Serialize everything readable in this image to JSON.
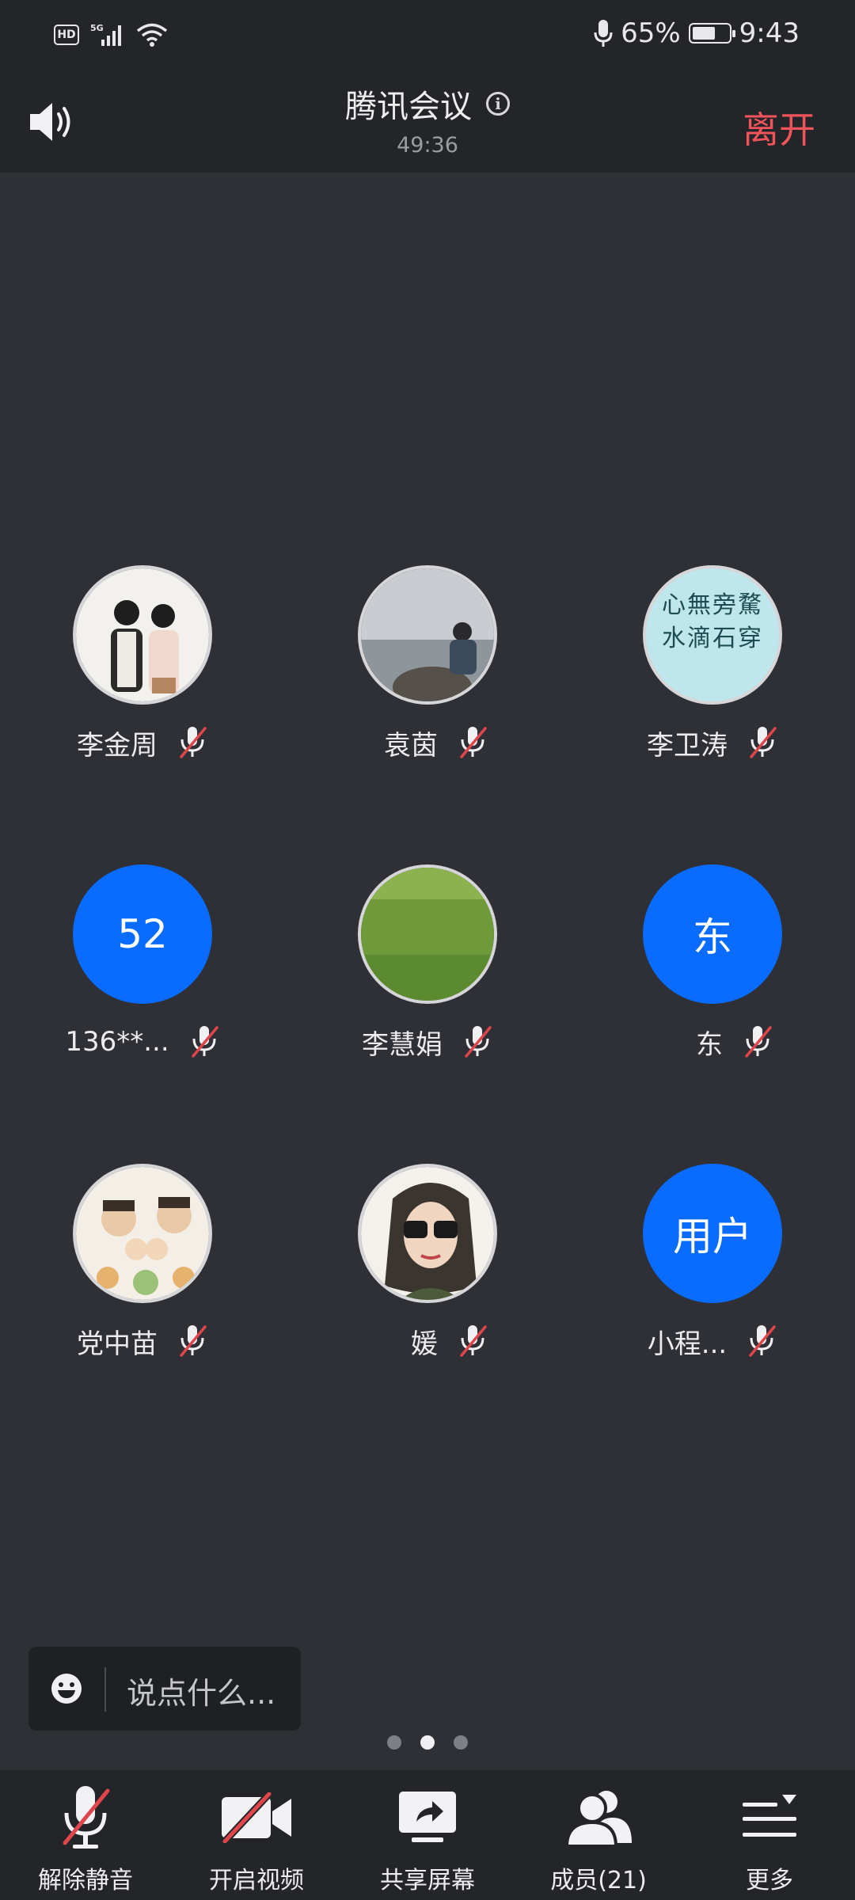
{
  "status_bar": {
    "network": "5G",
    "hd": "HD",
    "battery": "65%",
    "time": "9:43"
  },
  "header": {
    "title": "腾讯会议",
    "duration": "49:36",
    "leave_label": "离开"
  },
  "participants": [
    {
      "name": "李金周",
      "avatar_text": ""
    },
    {
      "name": "袁茵",
      "avatar_text": ""
    },
    {
      "name": "李卫涛",
      "avatar_text": ""
    },
    {
      "name": "136**...",
      "avatar_text": "52"
    },
    {
      "name": "李慧娟",
      "avatar_text": ""
    },
    {
      "name": "东",
      "avatar_text": "东"
    },
    {
      "name": "党中苗",
      "avatar_text": ""
    },
    {
      "name": "媛",
      "avatar_text": ""
    },
    {
      "name": "小程...",
      "avatar_text": "用户"
    }
  ],
  "avatar_image_text": "心無旁騖 水滴石穿",
  "chat": {
    "placeholder": "说点什么..."
  },
  "toolbar": {
    "unmute": "解除静音",
    "start_video": "开启视频",
    "share_screen": "共享屏幕",
    "members": "成员(21)",
    "more": "更多"
  },
  "colors": {
    "accent_blue": "#0a6cff",
    "leave_red": "#f2545b",
    "background": "#2e3036",
    "bar": "#242528"
  }
}
